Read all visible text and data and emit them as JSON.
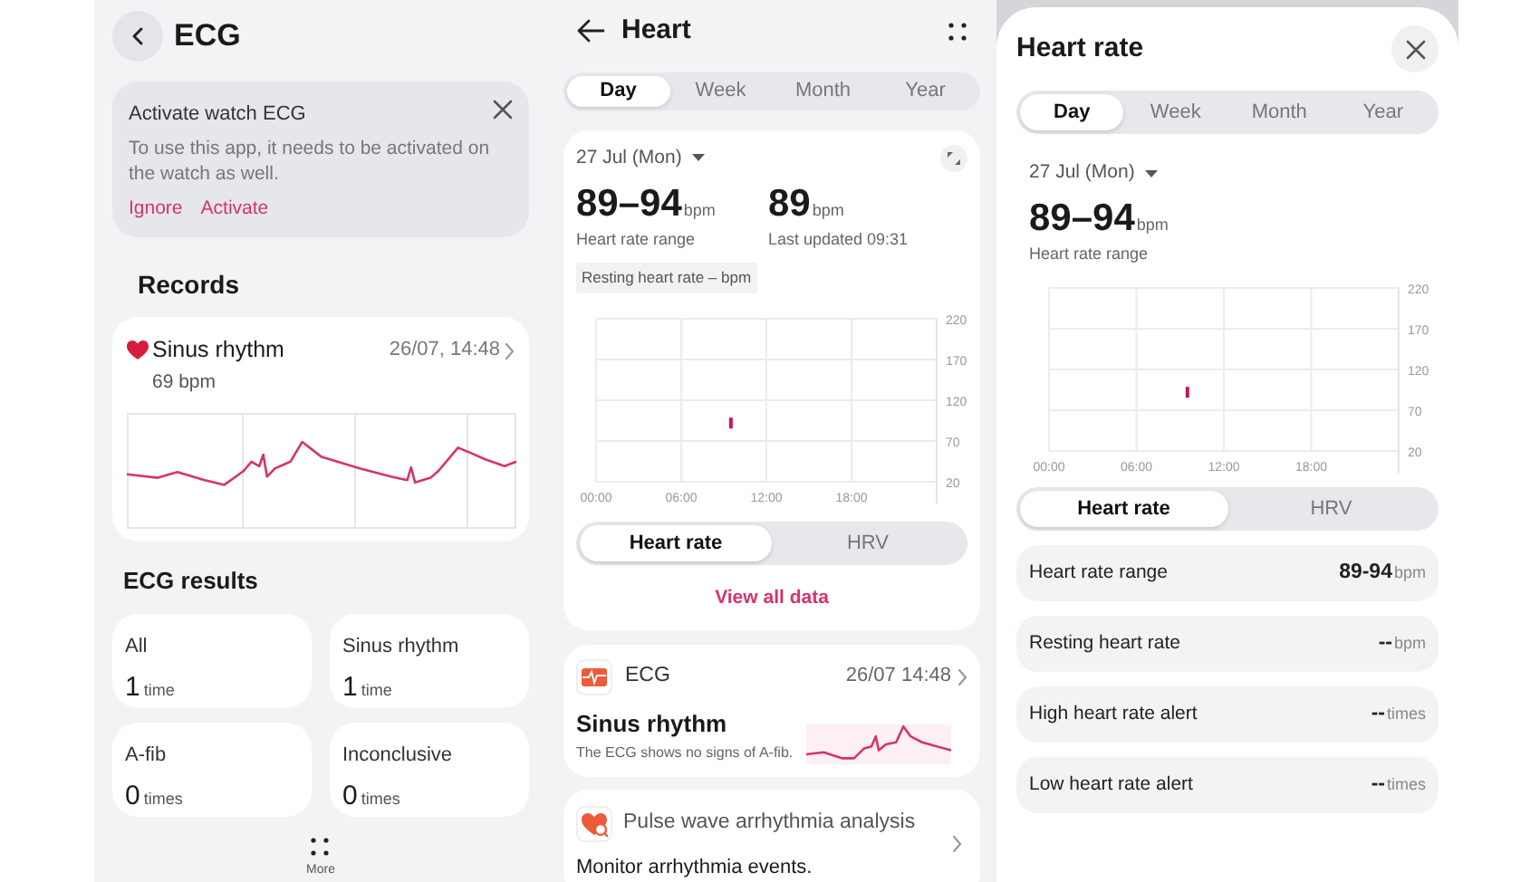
{
  "ecg_screen": {
    "title": "ECG",
    "notice": {
      "title": "Activate watch ECG",
      "message": "To use this app, it needs to be activated on the watch as well.",
      "actions": [
        "Ignore",
        "Activate"
      ]
    },
    "records_heading": "Records",
    "record": {
      "title": "Sinus rhythm",
      "time": "26/07, 14:48",
      "rate": "69 bpm"
    },
    "results_heading": "ECG results",
    "results": [
      {
        "label": "All",
        "count": "1",
        "unit": "time"
      },
      {
        "label": "Sinus rhythm",
        "count": "1",
        "unit": "time"
      },
      {
        "label": "A-fib",
        "count": "0",
        "unit": "times"
      },
      {
        "label": "Inconclusive",
        "count": "0",
        "unit": "times"
      }
    ],
    "more_label": "More"
  },
  "heart_screen": {
    "title": "Heart",
    "tabs": [
      {
        "label": "Day",
        "selected": true
      },
      {
        "label": "Week",
        "selected": false
      },
      {
        "label": "Month",
        "selected": false
      },
      {
        "label": "Year",
        "selected": false
      }
    ],
    "summary": {
      "date": "27 Jul (Mon)",
      "range": {
        "value": "89–94",
        "unit": "bpm",
        "label": "Heart rate range"
      },
      "latest": {
        "value": "89",
        "unit": "bpm",
        "label": "Last updated 09:31"
      },
      "resting_chip": "Resting heart rate – bpm",
      "chart_data": {
        "type": "scatter",
        "grid": true,
        "x": [
          9.5
        ],
        "series": [
          {
            "color": "#c2185b",
            "values": [
              92
            ]
          }
        ],
        "xlim": [
          0,
          24
        ],
        "ylim": [
          20,
          220
        ],
        "xticks": [
          {
            "value": 0,
            "label": "00:00"
          },
          {
            "value": 6,
            "label": "06:00"
          },
          {
            "value": 12,
            "label": "12:00"
          },
          {
            "value": 18,
            "label": "18:00"
          }
        ],
        "yticks": [
          20,
          70,
          120,
          170,
          220
        ]
      },
      "metric_toggle": [
        {
          "label": "Heart rate",
          "selected": true
        },
        {
          "label": "HRV",
          "selected": false
        }
      ],
      "view_all": "View all data"
    },
    "ecg_card": {
      "title": "ECG",
      "time": "26/07 14:48",
      "result": "Sinus rhythm",
      "description": "The ECG shows no signs of A-fib."
    },
    "pulse_card": {
      "title": "Pulse wave arrhythmia analysis",
      "subtitle": "Monitor arrhythmia events."
    }
  },
  "heart_rate_sheet": {
    "title": "Heart rate",
    "tabs": [
      {
        "label": "Day",
        "selected": true
      },
      {
        "label": "Week",
        "selected": false
      },
      {
        "label": "Month",
        "selected": false
      },
      {
        "label": "Year",
        "selected": false
      }
    ],
    "date": "27 Jul (Mon)",
    "range": {
      "value": "89–94",
      "unit": "bpm",
      "label": "Heart rate range"
    },
    "chart_data": {
      "type": "scatter",
      "grid": true,
      "x": [
        9.5
      ],
      "series": [
        {
          "color": "#c2185b",
          "values": [
            92
          ]
        }
      ],
      "xlim": [
        0,
        24
      ],
      "ylim": [
        20,
        220
      ],
      "xticks": [
        {
          "value": 0,
          "label": "00:00"
        },
        {
          "value": 6,
          "label": "06:00"
        },
        {
          "value": 12,
          "label": "12:00"
        },
        {
          "value": 18,
          "label": "18:00"
        }
      ],
      "yticks": [
        20,
        70,
        120,
        170,
        220
      ]
    },
    "metric_toggle": [
      {
        "label": "Heart rate",
        "selected": true
      },
      {
        "label": "HRV",
        "selected": false
      }
    ],
    "stats": [
      {
        "label": "Heart rate range",
        "value": "89-94",
        "unit": "bpm"
      },
      {
        "label": "Resting heart rate",
        "value": "--",
        "unit": "bpm"
      },
      {
        "label": "High heart rate alert",
        "value": "--",
        "unit": "times"
      },
      {
        "label": "Low heart rate alert",
        "value": "--",
        "unit": "times"
      }
    ]
  }
}
